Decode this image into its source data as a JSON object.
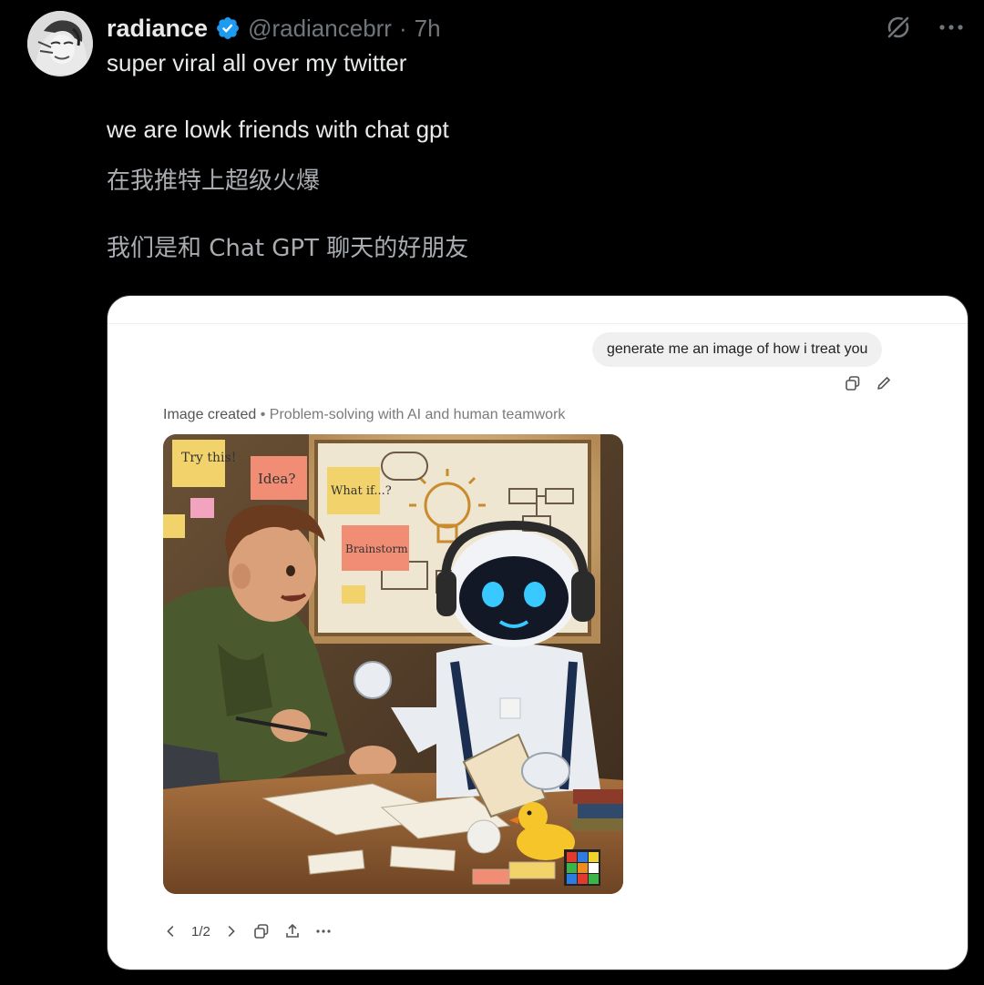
{
  "tweet": {
    "author_name": "radiance",
    "handle": "@radiancebrr",
    "separator": "·",
    "time": "7h",
    "lines": [
      "super viral all over my twitter",
      "we are lowk friends with chat gpt"
    ],
    "translation": [
      "在我推特上超级火爆",
      "我们是和 Chat GPT 聊天的好朋友"
    ]
  },
  "icons": {
    "verified": "verified-badge-icon",
    "grok": "grok-icon",
    "more": "more-icon"
  },
  "colors": {
    "verified_blue": "#1d9bf0",
    "background": "#000000",
    "secondary_text": "#71767b"
  },
  "chat": {
    "user_prompt": "generate me an image of how i treat you",
    "caption_label": "Image created",
    "caption_separator": "•",
    "caption_title": "Problem-solving with AI and human teamwork",
    "pager": "1/2"
  },
  "image_notes": {
    "note1": "Try this!",
    "note2": "Idea?",
    "note3": "What if...?",
    "note4": "Brainstorm"
  }
}
